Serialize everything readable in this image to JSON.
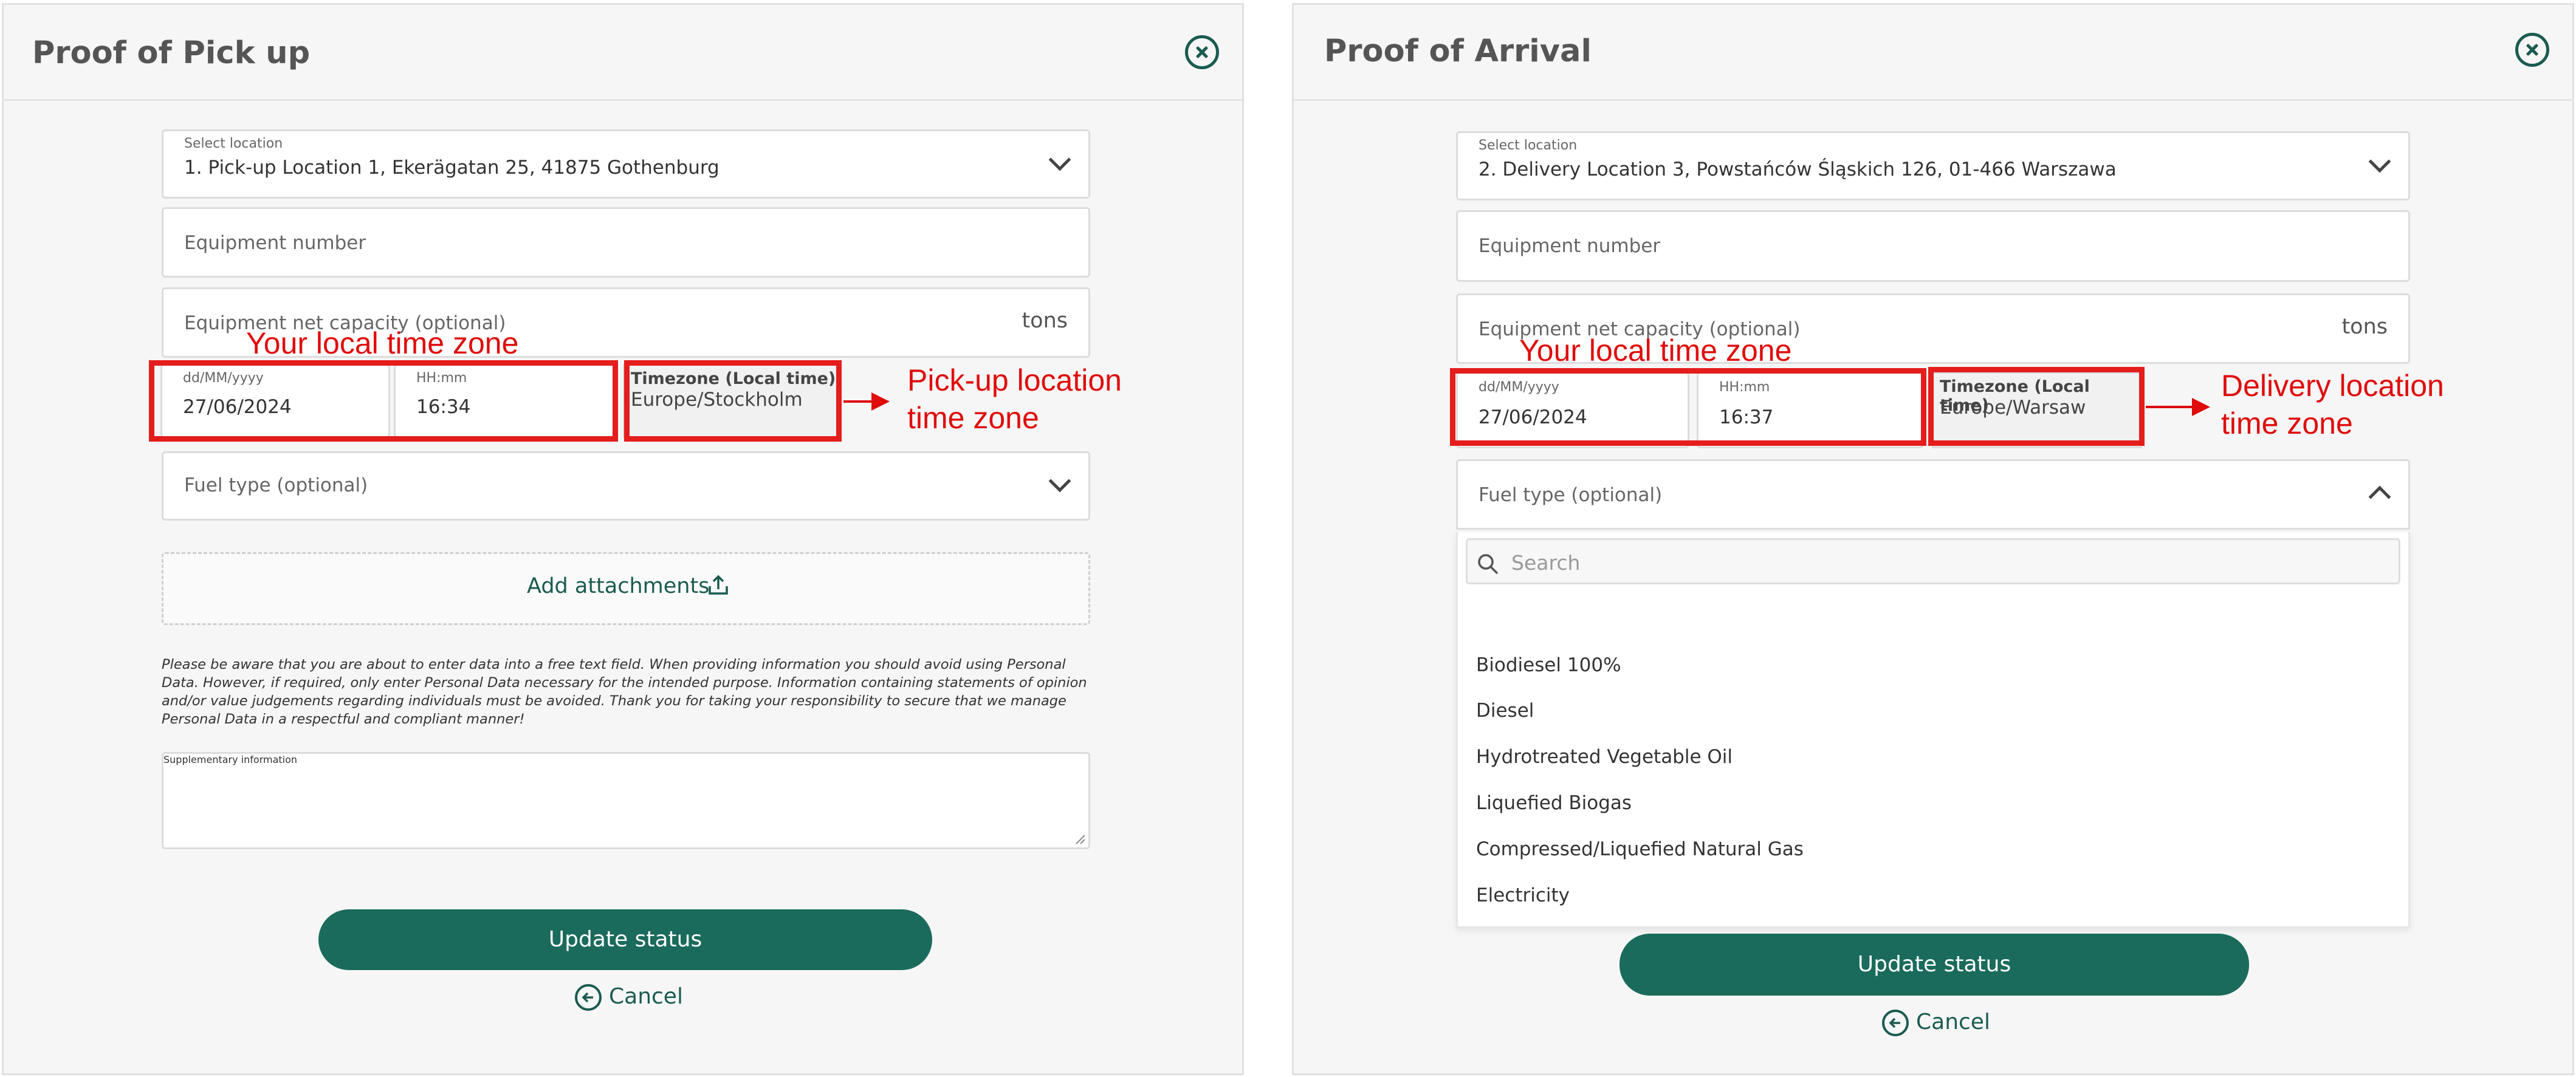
{
  "left": {
    "title": "Proof of Pick up",
    "location": {
      "label": "Select location",
      "value": "1. Pick-up Location 1,  Ekerägatan 25,   41875 Gothenburg"
    },
    "equipment_number": "Equipment number",
    "net_capacity": {
      "placeholder": "Equipment net capacity (optional)",
      "unit": "tons"
    },
    "date": {
      "label": "dd/MM/yyyy",
      "value": "27/06/2024"
    },
    "time": {
      "label": "HH:mm",
      "value": "16:34"
    },
    "timezone": {
      "label": "Timezone (Local time)",
      "value": "Europe/Stockholm"
    },
    "fuel_type": "Fuel type (optional)",
    "add_attachments": "Add attachments",
    "disclaimer": "Please be aware that you are about to enter data into a free text field. When providing information you should avoid using Personal Data. However, if required, only enter Personal Data necessary for the intended purpose. Information containing statements of opinion and/or value judgements regarding individuals must be avoided. Thank you for taking your responsibility to secure that we manage Personal Data in a respectful and compliant manner!",
    "supplementary": "Supplementary information",
    "update_status": "Update status",
    "cancel": "Cancel",
    "annotation_local": "Your local time zone",
    "annotation_location": "Pick-up location\ntime zone"
  },
  "right": {
    "title": "Proof of Arrival",
    "location": {
      "label": "Select location",
      "value": "2. Delivery Location 3,  Powstańców Śląskich 126,   01-466 Warszawa"
    },
    "equipment_number": "Equipment number",
    "net_capacity": {
      "placeholder": "Equipment net capacity (optional)",
      "unit": "tons"
    },
    "date": {
      "label": "dd/MM/yyyy",
      "value": "27/06/2024"
    },
    "time": {
      "label": "HH:mm",
      "value": "16:37"
    },
    "timezone": {
      "label": "Timezone (Local time)",
      "value": "Europe/Warsaw"
    },
    "fuel_type": "Fuel type (optional)",
    "search_placeholder": "Search",
    "fuel_options": [
      "Biodiesel 100%",
      "Diesel",
      "Hydrotreated Vegetable Oil",
      "Liquefied Biogas",
      "Compressed/Liquefied Natural Gas",
      "Electricity"
    ],
    "update_status": "Update status",
    "cancel": "Cancel",
    "annotation_local": "Your local time zone",
    "annotation_location": "Delivery location\ntime zone"
  },
  "colors": {
    "accent": "#1a6b5c",
    "annotation": "#e00b0b",
    "panel_bg": "#f6f6f6"
  }
}
